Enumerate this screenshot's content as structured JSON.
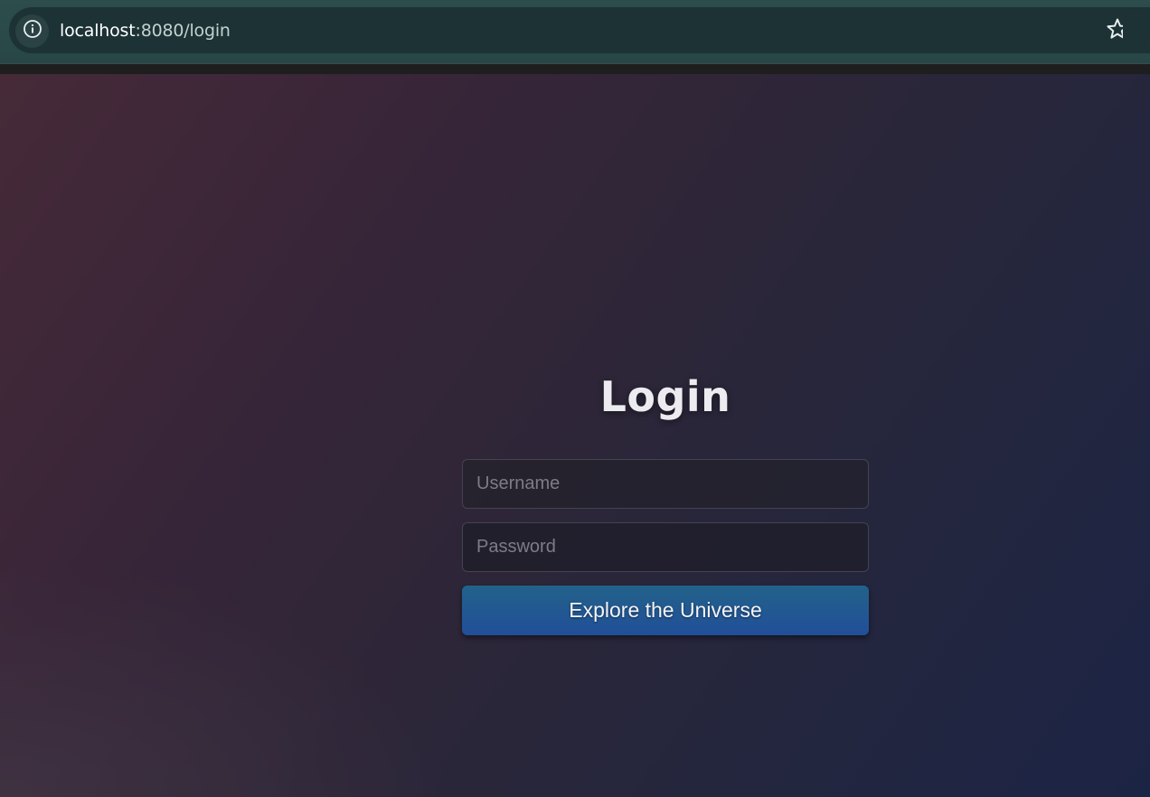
{
  "browser": {
    "url_host": "localhost",
    "url_path": ":8080/login",
    "site_info_icon": "info-circle-icon",
    "bookmark_icon": "star-outline-icon"
  },
  "login": {
    "title": "Login",
    "username_placeholder": "Username",
    "username_value": "",
    "password_placeholder": "Password",
    "password_value": "",
    "submit_label": "Explore the Universe"
  },
  "colors": {
    "chrome_bg": "#2d4d4d",
    "omnibox_bg": "#1c3234",
    "page_gradient_start": "#462a38",
    "page_gradient_end": "#1c2445",
    "button_top": "#22628a",
    "button_bottom": "#214f99"
  }
}
